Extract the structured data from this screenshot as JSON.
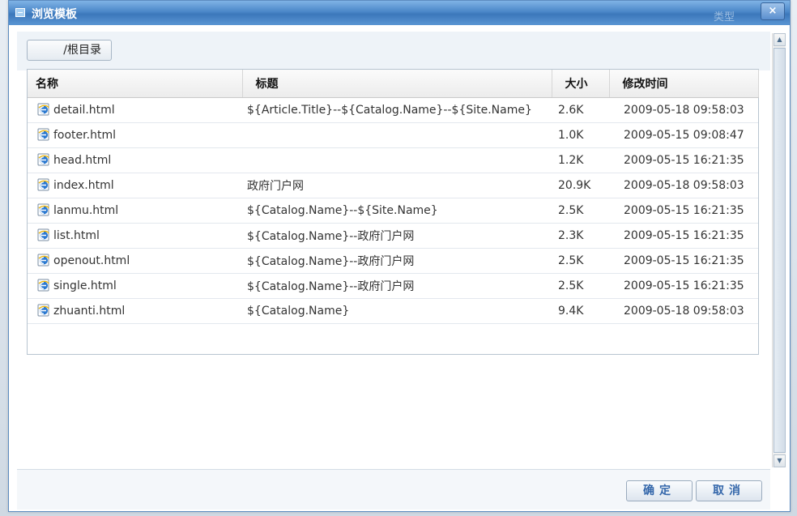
{
  "dialog": {
    "title": "浏览模板",
    "ghost_label": "类型",
    "close_label": "×"
  },
  "toolbar": {
    "path_label": "/根目录"
  },
  "table": {
    "columns": [
      "名称",
      "标题",
      "大小",
      "修改时间"
    ],
    "rows": [
      {
        "name": "detail.html",
        "title": "${Article.Title}--${Catalog.Name}--${Site.Name}",
        "size": "2.6K",
        "modified": "2009-05-18 09:58:03"
      },
      {
        "name": "footer.html",
        "title": "",
        "size": "1.0K",
        "modified": "2009-05-15 09:08:47"
      },
      {
        "name": "head.html",
        "title": "",
        "size": "1.2K",
        "modified": "2009-05-15 16:21:35"
      },
      {
        "name": "index.html",
        "title": "政府门户网",
        "size": "20.9K",
        "modified": "2009-05-18 09:58:03"
      },
      {
        "name": "lanmu.html",
        "title": "${Catalog.Name}--${Site.Name}",
        "size": "2.5K",
        "modified": "2009-05-15 16:21:35"
      },
      {
        "name": "list.html",
        "title": "${Catalog.Name}--政府门户网",
        "size": "2.3K",
        "modified": "2009-05-15 16:21:35"
      },
      {
        "name": "openout.html",
        "title": "${Catalog.Name}--政府门户网",
        "size": "2.5K",
        "modified": "2009-05-15 16:21:35"
      },
      {
        "name": "single.html",
        "title": "${Catalog.Name}--政府门户网",
        "size": "2.5K",
        "modified": "2009-05-15 16:21:35"
      },
      {
        "name": "zhuanti.html",
        "title": "${Catalog.Name}",
        "size": "9.4K",
        "modified": "2009-05-18 09:58:03"
      }
    ],
    "row_icon": "ie-html-file-icon"
  },
  "scrollbar": {
    "up_glyph": "▲",
    "down_glyph": "▼"
  },
  "footer": {
    "ok_label": "确定",
    "cancel_label": "取消"
  },
  "colors": {
    "titlebar": "#4b87c8",
    "accent_text": "#3366aa"
  }
}
